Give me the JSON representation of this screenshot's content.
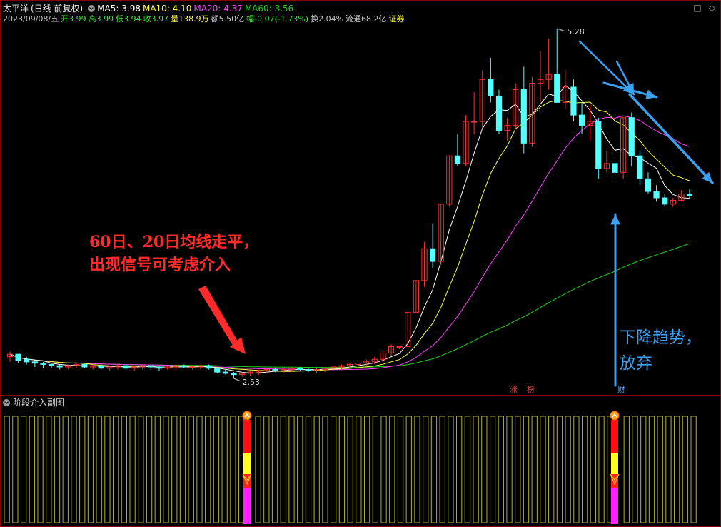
{
  "header": {
    "stock_name": "太平洋",
    "period": "(日线 前复权)",
    "ma5": "MA5: 3.98",
    "ma10": "MA10: 4.10",
    "ma20": "MA20: 4.37",
    "ma60": "MA60: 3.56",
    "date": "2023/09/08/五",
    "open": "开3.99",
    "high": "高3.99",
    "low": "低3.94",
    "close": "收3.97",
    "volume": "量138.9万",
    "amount": "额5.50亿",
    "change": "幅-0.07(-1.73%)",
    "turnover": "换2.04%",
    "float": "流通68.2亿",
    "sector": "证券",
    "icons": [
      "square-icon",
      "diamond-icon"
    ]
  },
  "annotations": {
    "buy_line1": "60日、20日均线走平，",
    "buy_line2": "出现信号可考虑介入",
    "sell_line1": "下降趋势，",
    "sell_line2": "放弃"
  },
  "markers": {
    "high_label": "5.28",
    "low_label": "2.53"
  },
  "badges": [
    "涨",
    "榜",
    "财"
  ],
  "sub_panel": {
    "title": "阶段介入副图"
  },
  "colors": {
    "up": "#ff3030",
    "down": "#54ffff",
    "ma5": "#ffffff",
    "ma10": "#ffff40",
    "ma20": "#ff40ff",
    "ma60": "#20d020",
    "annotation_red": "#ff2a2a",
    "annotation_blue": "#3aa0f0",
    "sub_bar": "#b0b030"
  },
  "chart_data": {
    "type": "candlestick",
    "y_range": [
      2.53,
      5.28
    ],
    "candles": [
      [
        2.7,
        2.74,
        2.66,
        2.72
      ],
      [
        2.72,
        2.72,
        2.65,
        2.67
      ],
      [
        2.68,
        2.7,
        2.64,
        2.66
      ],
      [
        2.66,
        2.67,
        2.62,
        2.65
      ],
      [
        2.65,
        2.66,
        2.61,
        2.64
      ],
      [
        2.64,
        2.65,
        2.61,
        2.63
      ],
      [
        2.63,
        2.64,
        2.6,
        2.62
      ],
      [
        2.62,
        2.64,
        2.6,
        2.63
      ],
      [
        2.63,
        2.65,
        2.61,
        2.64
      ],
      [
        2.64,
        2.65,
        2.61,
        2.62
      ],
      [
        2.62,
        2.64,
        2.6,
        2.63
      ],
      [
        2.63,
        2.64,
        2.6,
        2.61
      ],
      [
        2.61,
        2.63,
        2.59,
        2.62
      ],
      [
        2.62,
        2.64,
        2.6,
        2.63
      ],
      [
        2.63,
        2.64,
        2.6,
        2.61
      ],
      [
        2.61,
        2.63,
        2.59,
        2.62
      ],
      [
        2.62,
        2.64,
        2.6,
        2.63
      ],
      [
        2.63,
        2.64,
        2.6,
        2.62
      ],
      [
        2.62,
        2.63,
        2.59,
        2.61
      ],
      [
        2.61,
        2.63,
        2.6,
        2.62
      ],
      [
        2.62,
        2.64,
        2.6,
        2.63
      ],
      [
        2.63,
        2.64,
        2.61,
        2.62
      ],
      [
        2.62,
        2.63,
        2.6,
        2.62
      ],
      [
        2.62,
        2.64,
        2.6,
        2.63
      ],
      [
        2.63,
        2.64,
        2.6,
        2.61
      ],
      [
        2.61,
        2.62,
        2.57,
        2.58
      ],
      [
        2.58,
        2.6,
        2.56,
        2.57
      ],
      [
        2.57,
        2.58,
        2.53,
        2.56
      ],
      [
        2.56,
        2.58,
        2.54,
        2.57
      ],
      [
        2.57,
        2.59,
        2.55,
        2.58
      ],
      [
        2.58,
        2.6,
        2.56,
        2.59
      ],
      [
        2.59,
        2.61,
        2.57,
        2.6
      ],
      [
        2.6,
        2.61,
        2.58,
        2.59
      ],
      [
        2.59,
        2.61,
        2.57,
        2.6
      ],
      [
        2.6,
        2.62,
        2.58,
        2.61
      ],
      [
        2.61,
        2.62,
        2.59,
        2.6
      ],
      [
        2.6,
        2.61,
        2.58,
        2.59
      ],
      [
        2.59,
        2.61,
        2.57,
        2.6
      ],
      [
        2.6,
        2.62,
        2.58,
        2.61
      ],
      [
        2.61,
        2.62,
        2.59,
        2.62
      ],
      [
        2.62,
        2.64,
        2.6,
        2.63
      ],
      [
        2.63,
        2.65,
        2.61,
        2.64
      ],
      [
        2.64,
        2.66,
        2.62,
        2.65
      ],
      [
        2.65,
        2.68,
        2.63,
        2.66
      ],
      [
        2.66,
        2.7,
        2.64,
        2.68
      ],
      [
        2.68,
        2.75,
        2.66,
        2.73
      ],
      [
        2.73,
        2.8,
        2.71,
        2.78
      ],
      [
        2.78,
        2.78,
        2.76,
        2.78
      ],
      [
        2.78,
        3.05,
        2.78,
        3.05
      ],
      [
        3.05,
        3.3,
        3.05,
        3.3
      ],
      [
        3.3,
        3.6,
        3.25,
        3.55
      ],
      [
        3.55,
        3.75,
        3.4,
        3.45
      ],
      [
        3.45,
        3.9,
        3.42,
        3.9
      ],
      [
        3.9,
        4.28,
        3.88,
        4.28
      ],
      [
        4.28,
        4.45,
        4.2,
        4.22
      ],
      [
        4.22,
        4.6,
        4.2,
        4.55
      ],
      [
        4.55,
        4.78,
        4.45,
        4.55
      ],
      [
        4.55,
        4.95,
        4.5,
        4.88
      ],
      [
        4.88,
        5.05,
        4.7,
        4.75
      ],
      [
        4.75,
        4.8,
        4.45,
        4.48
      ],
      [
        4.48,
        4.58,
        4.4,
        4.52
      ],
      [
        4.52,
        4.85,
        4.5,
        4.8
      ],
      [
        4.8,
        4.98,
        4.3,
        4.38
      ],
      [
        4.38,
        4.9,
        4.35,
        4.85
      ],
      [
        4.85,
        5.1,
        4.7,
        4.88
      ],
      [
        4.88,
        5.2,
        4.8,
        4.92
      ],
      [
        4.92,
        5.28,
        4.85,
        4.7
      ],
      [
        4.7,
        4.95,
        4.65,
        4.82
      ],
      [
        4.82,
        4.88,
        4.55,
        4.6
      ],
      [
        4.6,
        4.7,
        4.45,
        4.52
      ],
      [
        4.52,
        4.68,
        4.4,
        4.55
      ],
      [
        4.55,
        4.58,
        4.1,
        4.18
      ],
      [
        4.18,
        4.32,
        4.15,
        4.22
      ],
      [
        4.22,
        4.25,
        4.08,
        4.15
      ],
      [
        4.15,
        4.58,
        4.1,
        4.58
      ],
      [
        4.58,
        4.62,
        4.2,
        4.28
      ],
      [
        4.28,
        4.32,
        4.05,
        4.1
      ],
      [
        4.1,
        4.15,
        3.98,
        4.0
      ],
      [
        4.0,
        4.05,
        3.92,
        3.95
      ],
      [
        3.95,
        3.98,
        3.88,
        3.9
      ],
      [
        3.9,
        3.95,
        3.88,
        3.93
      ],
      [
        3.93,
        4.01,
        3.92,
        3.98
      ],
      [
        3.98,
        4.02,
        3.94,
        3.97
      ]
    ],
    "signals": [
      2.53,
      4.58
    ]
  }
}
